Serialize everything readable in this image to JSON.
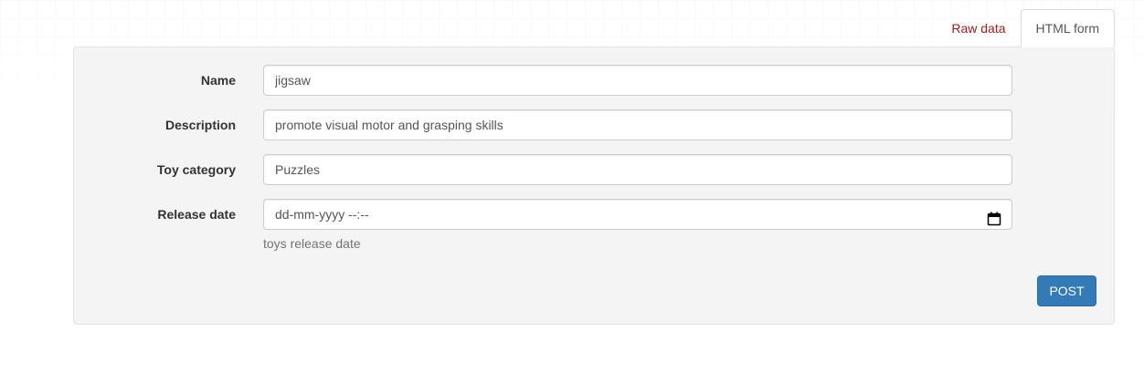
{
  "tabs": {
    "raw_data": "Raw data",
    "html_form": "HTML form"
  },
  "form": {
    "name": {
      "label": "Name",
      "value": "jigsaw"
    },
    "description": {
      "label": "Description",
      "value": "promote visual motor and grasping skills"
    },
    "toy_category": {
      "label": "Toy category",
      "value": "Puzzles"
    },
    "release_date": {
      "label": "Release date",
      "value": "dd-mm-yyyy --:--",
      "help": "toys release date",
      "icon": "calendar-icon"
    }
  },
  "actions": {
    "post_label": "POST"
  },
  "colors": {
    "link": "#a41d1d",
    "primary": "#337ab7",
    "panel_bg": "#f4f4f4"
  }
}
